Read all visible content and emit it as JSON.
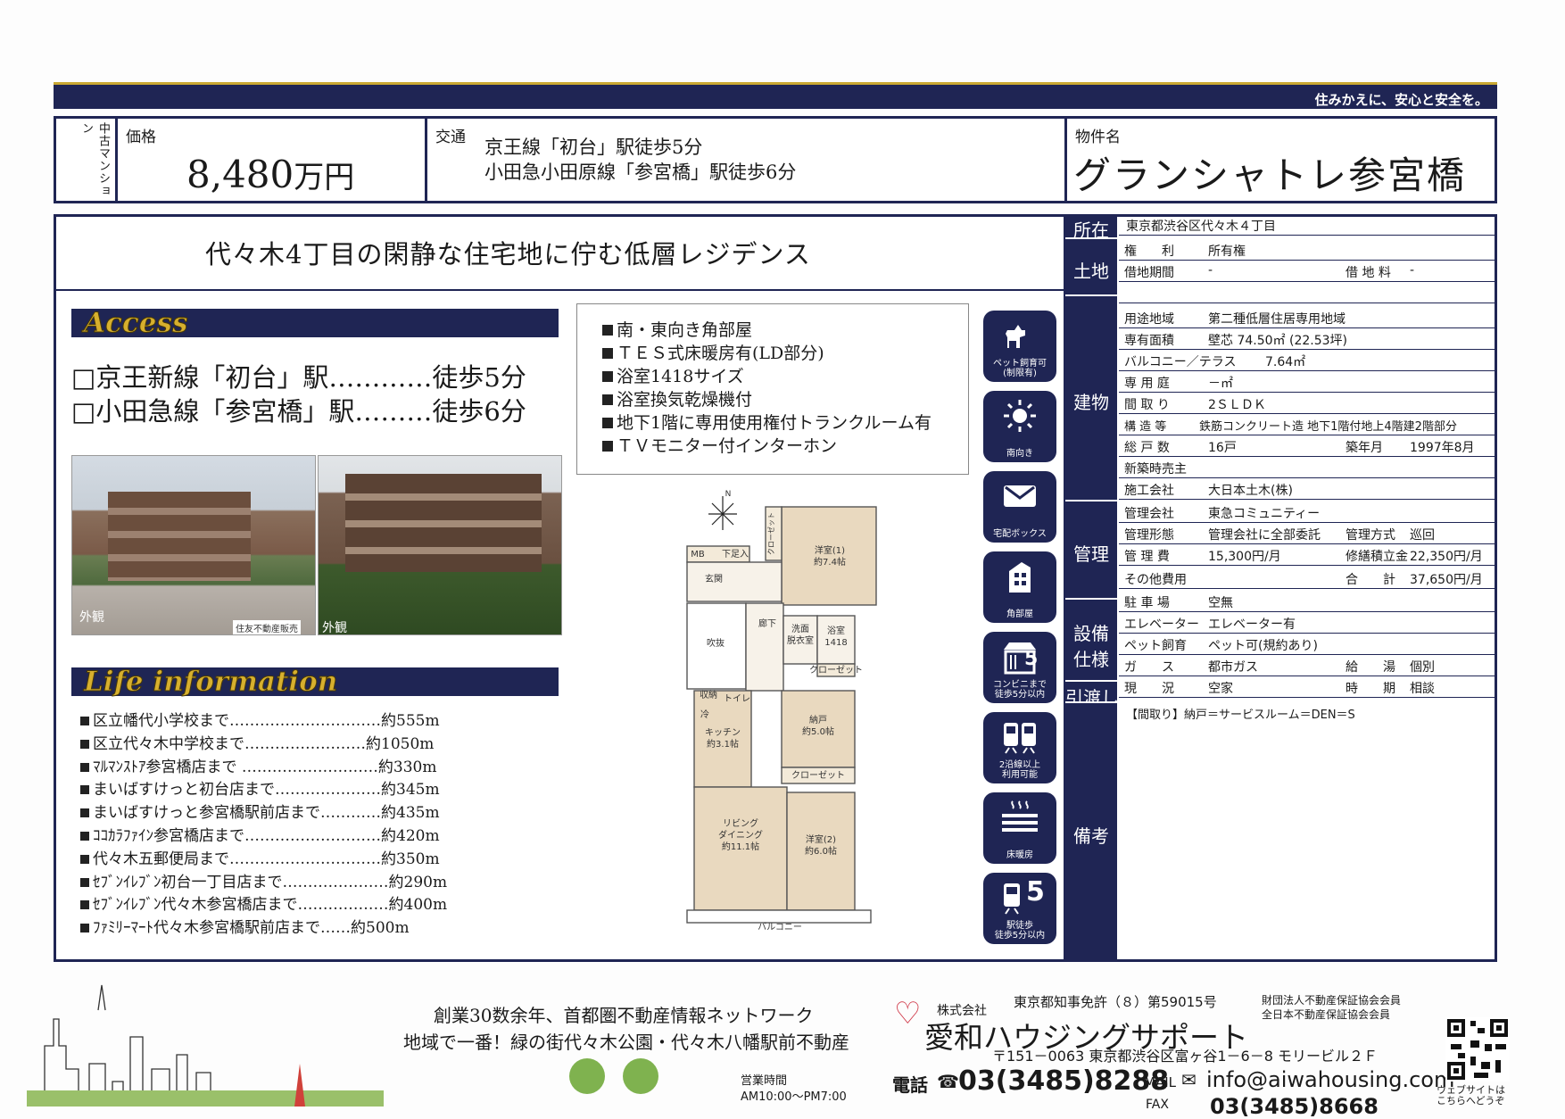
{
  "banner": {
    "slogan": "住みかえに、安心と安全を。"
  },
  "header": {
    "type_label": "中古マンション",
    "price_label": "価格",
    "price_value": "8,480",
    "price_unit": "万円",
    "traffic_label": "交通",
    "traffic_lines": [
      "京王線「初台」駅徒歩5分",
      "小田急小田原線「参宮橋」駅徒歩6分"
    ],
    "name_label": "物件名",
    "name_value": "グランシャトレ参宮橋"
  },
  "tagline": "代々木4丁目の閑静な住宅地に佇む低層レジデンス",
  "access": {
    "title": "Access",
    "lines": [
      "□京王新線「初台」駅…………徒歩5分",
      "□小田急線「参宮橋」駅………徒歩6分"
    ]
  },
  "photos": {
    "caption1": "外観",
    "watermark": "住友不動産販売",
    "caption2": "外観"
  },
  "life": {
    "title": "Life information",
    "items": [
      "区立幡代小学校まで…………………………約555m",
      "区立代々木中学校まで……………………約1050m",
      "ﾏﾙﾏﾝｽﾄｱ参宮橋店まで ………………………約330m",
      "まいばすけっと初台店まで…………………約345m",
      "まいばすけっと参宮橋駅前店まで…………約435m",
      "ｺｺｶﾗﾌｧｲﾝ参宮橋店まで………………………約420m",
      "代々木五郵便局まで…………………………約350m",
      "ｾﾌﾞﾝｲﾚﾌﾞﾝ初台一丁目店まで…………………約290m",
      "ｾﾌﾞﾝｲﾚﾌﾞﾝ代々木参宮橋店まで………………約400m",
      "ﾌｧﾐﾘｰﾏｰﾄ代々木参宮橋駅前店まで……約500m"
    ]
  },
  "features": [
    "南・東向き角部屋",
    "ＴＥＳ式床暖房有(LD部分)",
    "浴室1418サイズ",
    "浴室換気乾燥機付",
    "地下1階に専用使用権付トランクルーム有",
    "ＴＶモニター付インターホン"
  ],
  "floorplan": {
    "compass": "N",
    "rooms": {
      "closet1": "クローゼット",
      "western1": "洋室(1)\n約7.4帖",
      "mb": "MB",
      "shoebox": "下足入",
      "entrance": "玄関",
      "hall": "廊下",
      "void": "吹抜",
      "washroom": "洗面\n脱衣室",
      "bath": "浴室\n1418",
      "closet2": "クローゼット",
      "storage_shelf": "収納",
      "toilet": "トイレ",
      "refrig": "冷",
      "kitchen": "キッチン\n約3.1帖",
      "storeroom": "納戸\n約5.0帖",
      "closet3": "クローゼット",
      "living": "リビング\nダイニング\n約11.1帖",
      "western2": "洋室(2)\n約6.0帖",
      "balcony": "バルコニー"
    }
  },
  "icons": [
    {
      "name": "pet-icon",
      "label": "ペット飼育可\n(制限有)"
    },
    {
      "name": "sun-icon",
      "label": "南向き"
    },
    {
      "name": "mail-icon",
      "label": "宅配ボックス"
    },
    {
      "name": "corner-icon",
      "label": "角部屋"
    },
    {
      "name": "convenience-icon",
      "label": "コンビニまで\n徒歩5分以内"
    },
    {
      "name": "train-icon",
      "label": "2沿線以上\n利用可能"
    },
    {
      "name": "floor-heat-icon",
      "label": "床暖房"
    },
    {
      "name": "station-icon",
      "label": "駅徒歩\n徒歩5分以内"
    }
  ],
  "icon_numbers": {
    "convenience": "5",
    "station": "5"
  },
  "spec": {
    "groups": {
      "location": "所在",
      "land": "土地",
      "building": "建物",
      "management": "管理",
      "equipment": "設備\n仕様",
      "handover": "引渡し",
      "remarks": "備考"
    },
    "rows": [
      [
        "東京都渋谷区代々木４丁目",
        "",
        "",
        ""
      ],
      [
        "権　　利",
        "所有権",
        "",
        ""
      ],
      [
        "借地期間",
        "-",
        "借 地 料",
        "-"
      ],
      [
        "",
        "",
        "",
        ""
      ],
      [
        "用途地域",
        "第二種低層住居専用地域",
        "",
        ""
      ],
      [
        "専有面積",
        "壁芯 74.50㎡ (22.53坪)",
        "",
        ""
      ],
      [
        "バルコニー／テラス",
        "7.64㎡",
        "",
        ""
      ],
      [
        "専 用 庭",
        "－㎡",
        "",
        ""
      ],
      [
        "間 取 り",
        "2ＳＬＤＫ",
        "",
        ""
      ],
      [
        "構 造 等",
        "鉄筋コンクリート造 地下1階付地上4階建2階部分",
        "",
        ""
      ],
      [
        "総 戸 数",
        "16戸",
        "築年月",
        "1997年8月"
      ],
      [
        "新築時売主",
        "",
        "",
        ""
      ],
      [
        "施工会社",
        "大日本土木(株)",
        "",
        ""
      ],
      [
        "管理会社",
        "東急コミュニティー",
        "",
        ""
      ],
      [
        "管理形態",
        "管理会社に全部委託",
        "管理方式",
        "巡回"
      ],
      [
        "管 理 費",
        "15,300円/月",
        "修繕積立金",
        "22,350円/月"
      ],
      [
        "その他費用",
        "",
        "合　　計",
        "37,650円/月"
      ],
      [
        "駐 車 場",
        "空無",
        "",
        ""
      ],
      [
        "エレベーター",
        "エレベーター有",
        "",
        ""
      ],
      [
        "ペット飼育",
        "ペット可(規約あり)",
        "",
        ""
      ],
      [
        "ガ　　ス",
        "都市ガス",
        "給　　湯",
        "個別"
      ],
      [
        "現　　況",
        "空家",
        "時　　期",
        "相談"
      ]
    ],
    "remarks": "【間取り】納戸＝サービスルーム＝DEN＝S"
  },
  "footer": {
    "slogan1": "創業30数余年、首都圏不動産情報ネットワーク",
    "slogan2": "地域で一番！緑の街代々木公園・代々木八幡駅前不動産",
    "hours_label": "営業時間",
    "hours": "AM10:00～PM7:00",
    "company_prefix": "株式会社",
    "company": "愛和ハウジングサポート",
    "license": "東京都知事免許（８）第59015号",
    "assoc1": "財団法人不動産保証協会会員",
    "assoc2": "全日本不動産保証協会会員",
    "address": "〒151－0063 東京都渋谷区富ヶ谷1－6－8 モリービル２Ｆ",
    "tel_label": "電話",
    "tel": "03(3485)8288",
    "mail_label": "MAIL",
    "mail": "info@aiwahousing.com",
    "fax_label": "FAX",
    "fax": "03(3485)8668",
    "web": "ウェブサイトは\nこちらへどうぞ"
  },
  "colors": {
    "navy": "#1f2554",
    "gold": "#c9a833"
  }
}
